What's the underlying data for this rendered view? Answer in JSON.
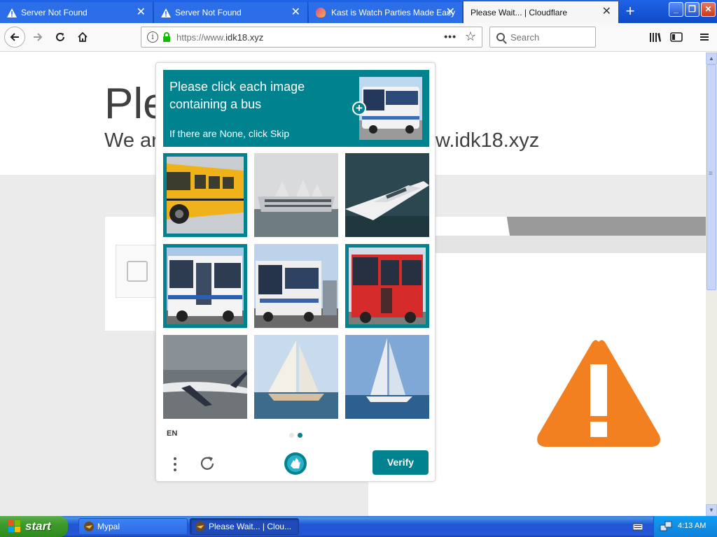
{
  "browser": {
    "tabs": [
      {
        "title": "Server Not Found",
        "icon": "warning-icon",
        "active": false
      },
      {
        "title": "Server Not Found",
        "icon": "warning-icon",
        "active": false
      },
      {
        "title": "Kast is Watch Parties Made Easy",
        "icon": "kast-icon",
        "active": false
      },
      {
        "title": "Please Wait... | Cloudflare",
        "icon": "none",
        "active": true
      }
    ],
    "close_glyph": "✕",
    "new_tab_glyph": "+",
    "window_buttons": {
      "minimize": "_",
      "maximize": "❐",
      "close": "✕"
    },
    "url": {
      "scheme": "https://www.",
      "host": "idk18.xyz"
    },
    "url_info_glyph": "i",
    "page_actions_glyph": "•••",
    "bookmark_glyph": "☆",
    "search_placeholder": "Search"
  },
  "page": {
    "title": "Ple",
    "subtitle_left": "We ar",
    "subtitle_right": "w.idk18.xyz",
    "alert_color": "#f38020"
  },
  "captcha": {
    "prompt": "Please click each image containing a bus",
    "hint": "If there are None, click Skip",
    "accent_color": "#00838f",
    "tiles": [
      {
        "subject": "yellow school bus",
        "selected": true
      },
      {
        "subject": "cruise ship",
        "selected": false
      },
      {
        "subject": "motor yacht",
        "selected": false
      },
      {
        "subject": "white bus",
        "selected": true
      },
      {
        "subject": "white bus front",
        "selected": false
      },
      {
        "subject": "red bus",
        "selected": true
      },
      {
        "subject": "airplane",
        "selected": false
      },
      {
        "subject": "sailboat",
        "selected": false
      },
      {
        "subject": "sailboat",
        "selected": false
      }
    ],
    "language": "EN",
    "verify_label": "Verify",
    "page_index": 2,
    "page_count": 2
  },
  "taskbar": {
    "start_label": "start",
    "tasks": [
      {
        "label": "Mypal",
        "active": false
      },
      {
        "label": "Please Wait... | Clou...",
        "active": true
      }
    ],
    "clock": "4:13 AM"
  }
}
